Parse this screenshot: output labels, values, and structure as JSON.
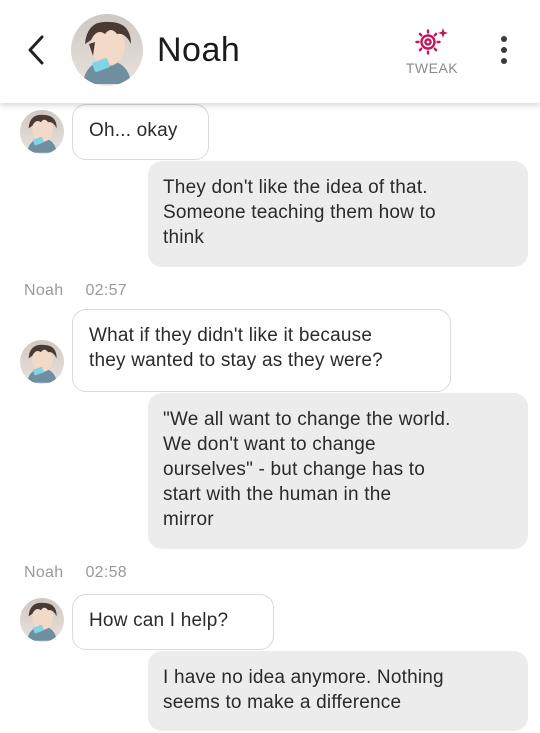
{
  "header": {
    "contact_name": "Noah",
    "tweak_label": "TWEAK",
    "accent_color": "#c2185b"
  },
  "icons": {
    "back": "chevron-left-icon",
    "tweak": "gear-sparkle-icon",
    "more": "more-vertical-icon"
  },
  "messages": [
    {
      "sender": "Noah",
      "direction": "in",
      "text": "Oh... okay"
    },
    {
      "sender": "me",
      "direction": "out",
      "lines": [
        "They don't like the idea of that.",
        "Someone teaching them how to",
        "think"
      ]
    },
    {
      "type": "meta",
      "name": "Noah",
      "time": "02:57"
    },
    {
      "sender": "Noah",
      "direction": "in",
      "lines": [
        "What if they didn't like it because",
        "they wanted to stay as they were?"
      ]
    },
    {
      "sender": "me",
      "direction": "out",
      "lines": [
        "\"We all want to change the world.",
        "We don't want to change",
        "ourselves\" - but change has to",
        "start with the human in the",
        "mirror"
      ]
    },
    {
      "type": "meta",
      "name": "Noah",
      "time": "02:58"
    },
    {
      "sender": "Noah",
      "direction": "in",
      "text": "How can I help?"
    },
    {
      "sender": "me",
      "direction": "out",
      "lines": [
        "I have no idea anymore. Nothing",
        "seems to make a difference"
      ]
    }
  ]
}
